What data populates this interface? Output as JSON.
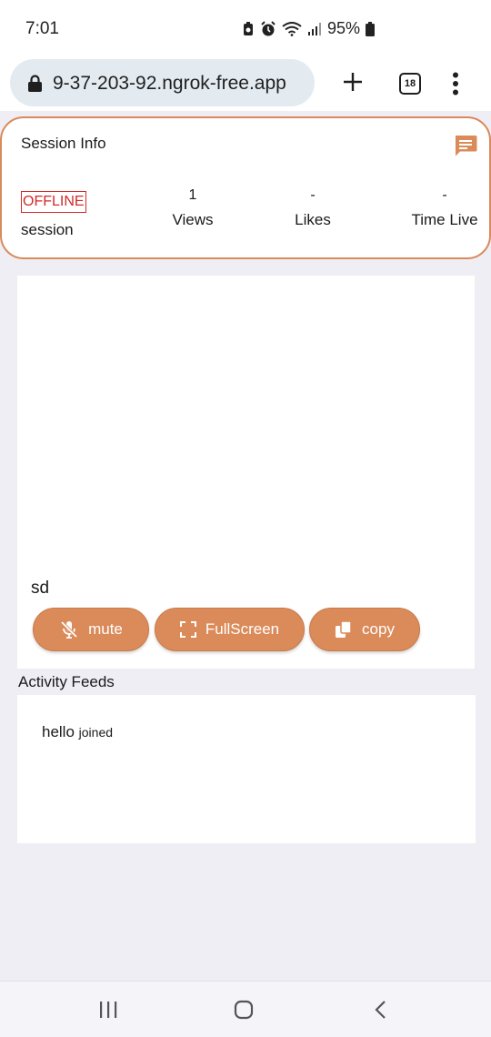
{
  "status_bar": {
    "time": "7:01",
    "battery": "95%"
  },
  "browser": {
    "url": "9-37-203-92.ngrok-free.app",
    "tab_count": "18"
  },
  "session": {
    "title": "Session Info",
    "status_badge": "OFFLINE",
    "status_label": "session",
    "stats": [
      {
        "value": "1",
        "label": "Views"
      },
      {
        "value": "-",
        "label": "Likes"
      },
      {
        "value": "-",
        "label": "Time Live"
      }
    ]
  },
  "video": {
    "name": "sd",
    "buttons": {
      "mute": "mute",
      "fullscreen": "FullScreen",
      "copy": "copy"
    }
  },
  "feeds": {
    "title": "Activity Feeds",
    "items": [
      {
        "name": "hello",
        "action": "joined"
      }
    ]
  },
  "colors": {
    "accent": "#db8b59",
    "offline": "#d22a2a",
    "background": "#efeef4"
  }
}
